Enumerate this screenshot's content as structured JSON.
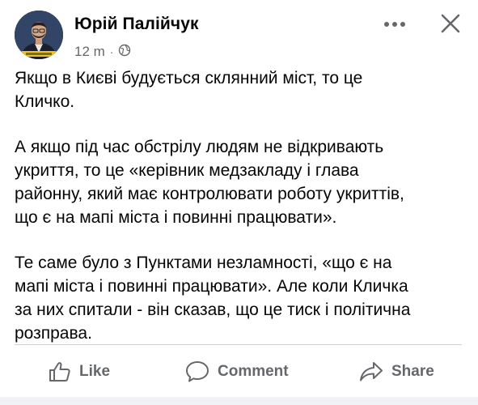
{
  "post": {
    "author": "Юрій Палійчук",
    "time": "12 m",
    "separator": "·",
    "audience_icon": "globe-icon",
    "paragraphs": [
      "Якщо в Києві будується склянний міст, то це\nКличко.",
      "А якщо під час обстрілу людям не відкривають\nукриття, то це «керівник медзакладу і глава\nрайонну, який має контролювати роботу укриттів,\nщо є на мапі міста і повинні працювати».",
      "Те саме було з Пунктами незламності, «що є на\nмапі міста і повинні працювати». Але коли Кличка\nза них спитали - він сказав, що це тиск і політична\nрозправа."
    ]
  },
  "header_controls": {
    "more_icon": "more-horizontal-icon",
    "close_icon": "close-icon"
  },
  "actions": {
    "like_label": "Like",
    "comment_label": "Comment",
    "share_label": "Share"
  },
  "colors": {
    "text_primary": "#050505",
    "text_secondary": "#65676b",
    "divider": "#ced0d4"
  }
}
